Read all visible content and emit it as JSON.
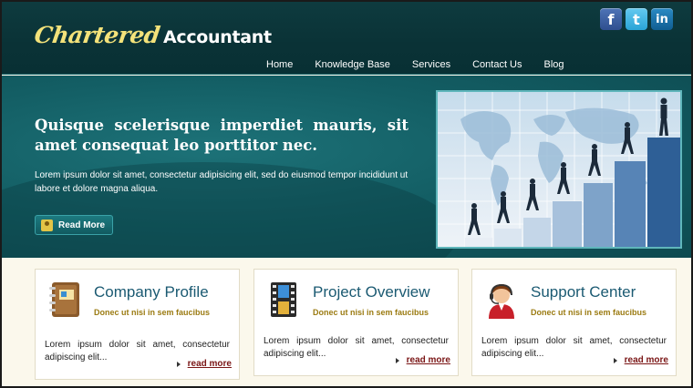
{
  "logo": {
    "script": "Chartered",
    "rest": "Accountant"
  },
  "social": [
    {
      "name": "facebook",
      "glyph": "f"
    },
    {
      "name": "twitter",
      "glyph": "t"
    },
    {
      "name": "linkedin",
      "glyph": "in"
    }
  ],
  "nav": [
    "Home",
    "Knowledge Base",
    "Services",
    "Contact Us",
    "Blog"
  ],
  "banner": {
    "heading": "Quisque scelerisque imperdiet mauris, sit amet consequat leo porttitor nec.",
    "text": "Lorem ipsum dolor sit amet, consectetur adipisicing elit, sed do eiusmod tempor incididunt ut labore et dolore magna aliqua.",
    "button_label": "Read More"
  },
  "cards": [
    {
      "icon": "notebook-icon",
      "title": "Company Profile",
      "subtitle": "Donec ut nisi in sem faucibus",
      "text": "Lorem ipsum dolor sit amet, consectetur adipiscing elit...",
      "more": "read more"
    },
    {
      "icon": "film-strip-icon",
      "title": "Project Overview",
      "subtitle": "Donec ut nisi in sem faucibus",
      "text": "Lorem ipsum dolor sit amet, consectetur adipiscing elit...",
      "more": "read more"
    },
    {
      "icon": "support-agent-icon",
      "title": "Support Center",
      "subtitle": "Donec ut nisi in sem faucibus",
      "text": "Lorem ipsum dolor sit amet, consectetur adipiscing elit...",
      "more": "read more"
    }
  ],
  "colors": {
    "header": "#0a3236",
    "banner": "#135e64",
    "logo_accent": "#f3e27a",
    "link": "#7a1515",
    "card_title": "#1b5a72",
    "card_sub": "#9b7b12"
  }
}
